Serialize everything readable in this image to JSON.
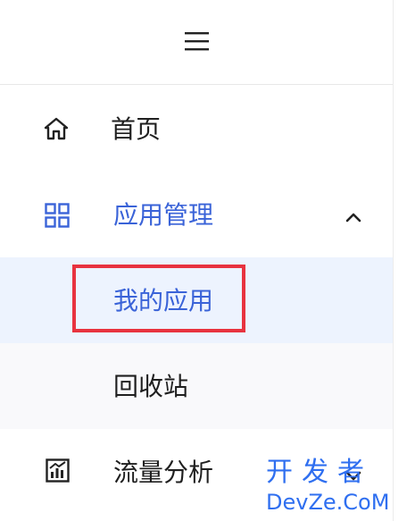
{
  "menu": {
    "toggle_icon": "hamburger-menu-icon",
    "items": [
      {
        "label": "首页",
        "icon": "home-icon",
        "state": "default"
      },
      {
        "label": "应用管理",
        "icon": "grid-apps-icon",
        "state": "open",
        "expand_icon": "chevron-up-icon",
        "children": [
          {
            "label": "我的应用",
            "state": "selected"
          },
          {
            "label": "回收站",
            "state": "default"
          }
        ]
      },
      {
        "label": "流量分析",
        "icon": "chart-icon",
        "state": "collapsed",
        "expand_icon": "chevron-down-icon"
      }
    ]
  },
  "colors": {
    "active_blue": "#3a63d8",
    "selected_bg": "#edf3fe",
    "highlight_red": "#e8333f",
    "text": "#1f1f1f"
  },
  "watermark": {
    "line1": "开发者",
    "line2": "DevZe.CoM"
  }
}
